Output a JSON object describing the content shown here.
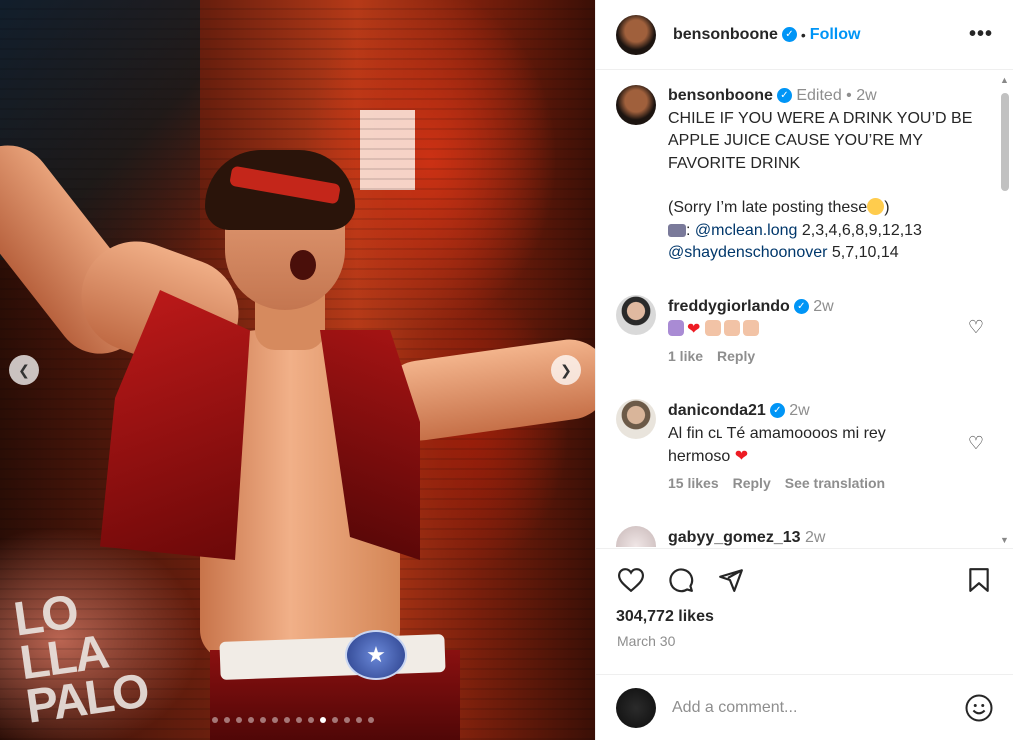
{
  "post": {
    "username": "bensonboone",
    "follow_label": "Follow",
    "sep": "•",
    "more_label": "•••"
  },
  "caption": {
    "username": "bensonboone",
    "edited": "Edited",
    "sep": "•",
    "time": "2w",
    "line1": "CHILE IF YOU WERE A DRINK YOU’D BE APPLE JUICE CAUSE YOU’RE MY FAVORITE DRINK",
    "sorry": "(Sorry I’m late posting these",
    "sorry_end": ")",
    "credit_colon": ": ",
    "mention1": "@mclean.long",
    "nums1": " 2,3,4,6,8,9,12,13",
    "mention2": "@shaydenschoonover",
    "nums2": " 5,7,10,14"
  },
  "comments": [
    {
      "username": "freddygiorlando",
      "time": "2w",
      "likes": "1 like",
      "reply": "Reply"
    },
    {
      "username": "daniconda21",
      "time": "2w",
      "text": "Al fin cʟ Té amamoooos mi rey hermoso",
      "likes": "15 likes",
      "reply": "Reply",
      "translate": "See translation"
    },
    {
      "username": "gabyy_gomez_13",
      "time": "2w"
    }
  ],
  "actions": {
    "likes": "304,772 likes",
    "date": "March 30"
  },
  "add_comment": {
    "placeholder": "Add a comment..."
  },
  "media": {
    "logo_text": "lolla palo oza",
    "carousel_count": 14,
    "carousel_active": 10
  },
  "colors": {
    "accent": "#0095f6",
    "link": "#00376b",
    "muted": "#8e8e8e"
  }
}
